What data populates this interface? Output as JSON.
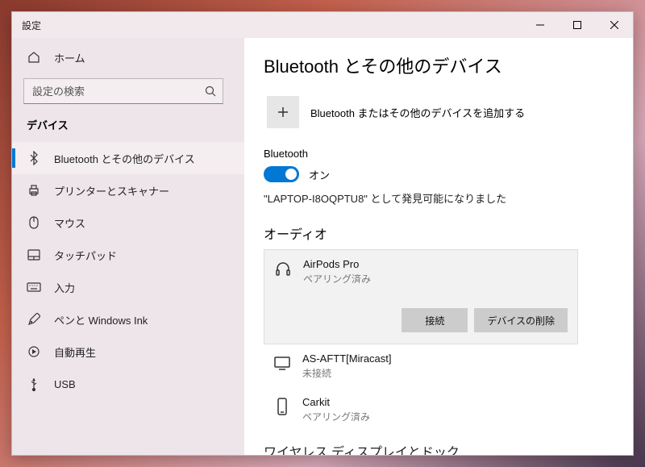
{
  "window": {
    "title": "設定"
  },
  "sidebar": {
    "home_label": "ホーム",
    "search_placeholder": "設定の検索",
    "category_title": "デバイス",
    "items": [
      {
        "label": "Bluetooth とその他のデバイス"
      },
      {
        "label": "プリンターとスキャナー"
      },
      {
        "label": "マウス"
      },
      {
        "label": "タッチパッド"
      },
      {
        "label": "入力"
      },
      {
        "label": "ペンと Windows Ink"
      },
      {
        "label": "自動再生"
      },
      {
        "label": "USB"
      }
    ]
  },
  "main": {
    "heading": "Bluetooth とその他のデバイス",
    "add_device_label": "Bluetooth またはその他のデバイスを追加する",
    "bt_label": "Bluetooth",
    "bt_state": "オン",
    "discoverable_text": "\"LAPTOP-I8OQPTU8\" として発見可能になりました",
    "audio_heading": "オーディオ",
    "devices": [
      {
        "name": "AirPods Pro",
        "status": "ペアリング済み"
      },
      {
        "name": "AS-AFTT[Miracast]",
        "status": "未接続"
      },
      {
        "name": "Carkit",
        "status": "ペアリング済み"
      }
    ],
    "connect_btn": "接続",
    "remove_btn": "デバイスの削除",
    "next_heading": "ワイヤレス ディスプレイとドック"
  }
}
